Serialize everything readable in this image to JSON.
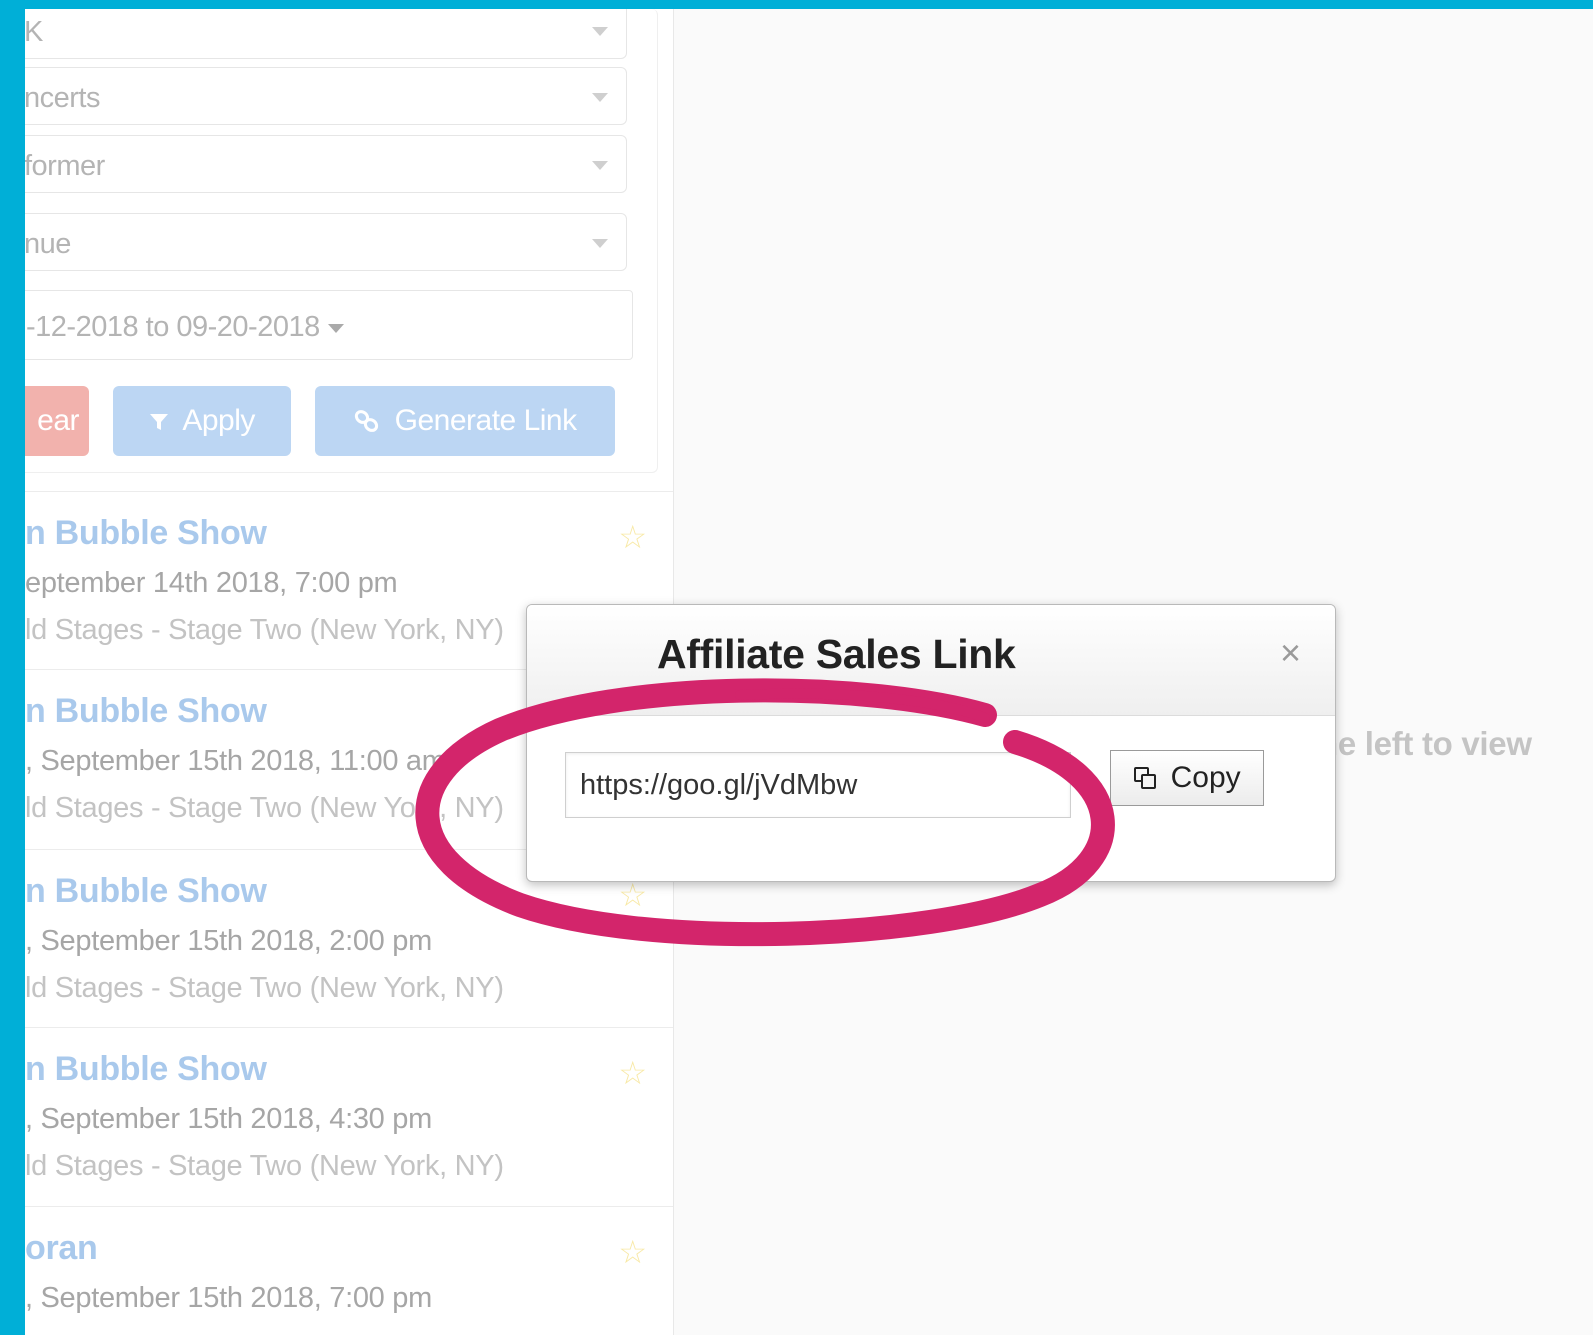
{
  "filters": {
    "category": "K",
    "type": "ncerts",
    "performer": "former",
    "venue": "nue",
    "date_range": "-12-2018 to 09-20-2018"
  },
  "buttons": {
    "clear": "ear",
    "apply": "Apply",
    "generate": "Generate Link"
  },
  "events": [
    {
      "title": "n Bubble Show",
      "date": "eptember 14th 2018, 7:00 pm",
      "venue": "ld Stages - Stage Two (New York, NY)"
    },
    {
      "title": "n Bubble Show",
      "date": ", September 15th 2018, 11:00 am",
      "venue": "ld Stages - Stage Two (New York, NY)"
    },
    {
      "title": "n Bubble Show",
      "date": ", September 15th 2018, 2:00 pm",
      "venue": "ld Stages - Stage Two (New York, NY)"
    },
    {
      "title": "n Bubble Show",
      "date": ", September 15th 2018, 4:30 pm",
      "venue": "ld Stages - Stage Two (New York, NY)"
    },
    {
      "title": "oran",
      "date": ", September 15th 2018, 7:00 pm",
      "venue": ""
    }
  ],
  "main": {
    "hint": "he left to view"
  },
  "modal": {
    "title": "Affiliate Sales Link",
    "close": "×",
    "link_value": "https://goo.gl/jVdMbw",
    "copy_label": "Copy"
  },
  "icons": {
    "filter": "filter-icon",
    "link": "link-icon",
    "copy": "copy-icon",
    "star": "star-icon"
  },
  "colors": {
    "frame": "#00afd7",
    "annotation": "#d3256b"
  }
}
